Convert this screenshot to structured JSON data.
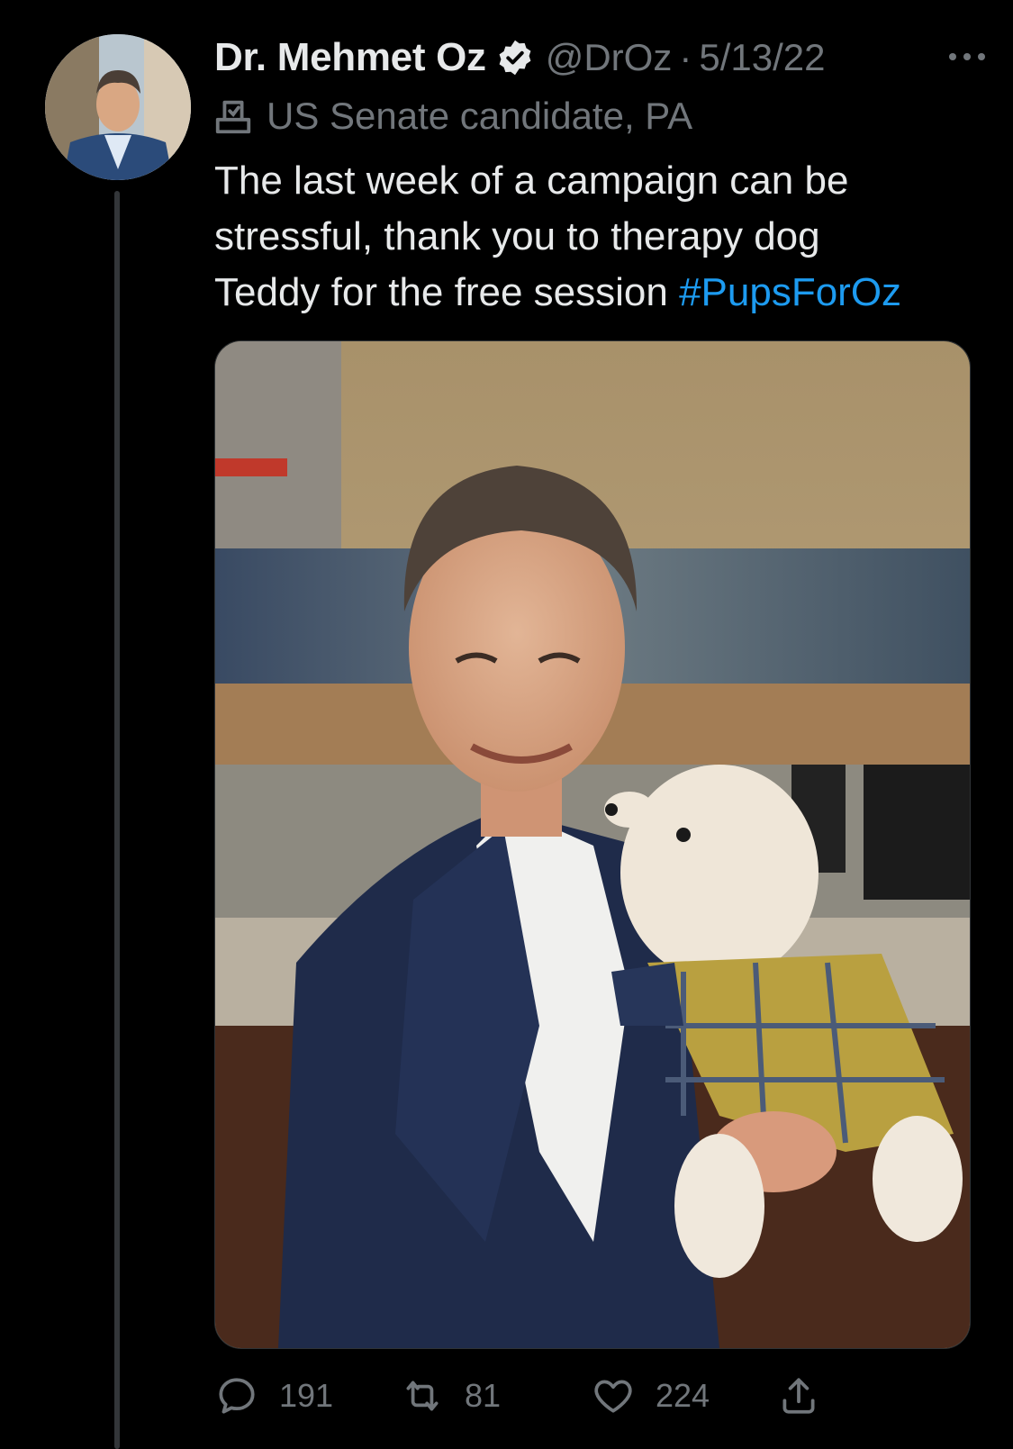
{
  "tweet": {
    "author": {
      "display_name": "Dr. Mehmet Oz",
      "handle": "@DrOz",
      "separator": "·",
      "date": "5/13/22",
      "verified_icon": "verified-badge-icon",
      "label_icon": "ballot-box-icon",
      "label": "US Senate candidate, PA"
    },
    "text": {
      "line1": "The last week of a campaign can be",
      "line2": "stressful, thank you to therapy dog",
      "line3_plain": "Teddy for the free session ",
      "hashtag": "#PupsForOz"
    },
    "stats": {
      "replies": "191",
      "retweets": "81",
      "likes": "224"
    },
    "colors": {
      "background": "#000000",
      "primary_text": "#e7e9ea",
      "secondary_text": "#71767b",
      "link": "#1d9bf0"
    }
  }
}
